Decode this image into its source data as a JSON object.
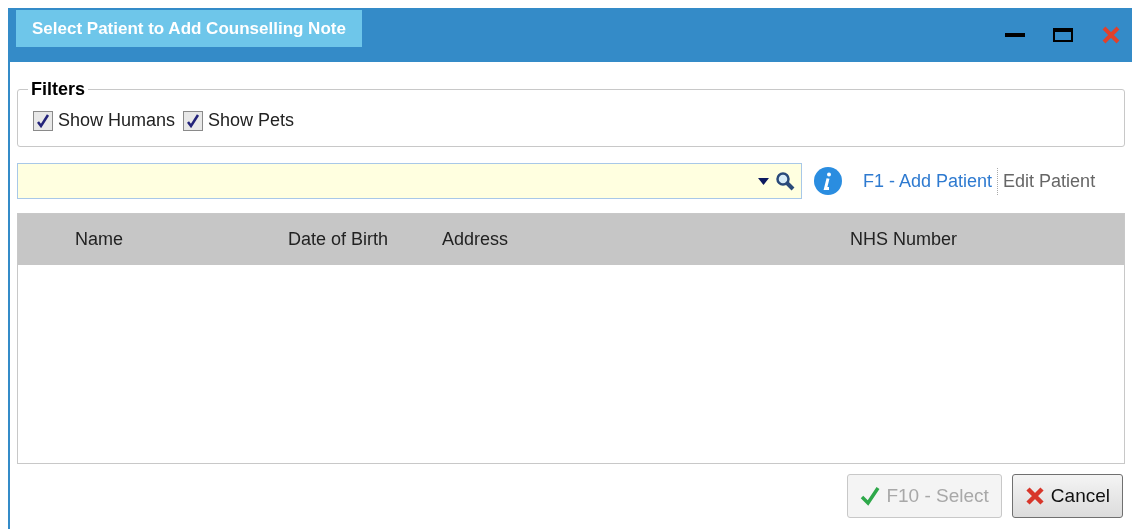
{
  "window": {
    "title": "Select Patient to Add Counselling Note"
  },
  "filters": {
    "legend": "Filters",
    "options": [
      {
        "label": "Show Humans",
        "checked": true
      },
      {
        "label": "Show Pets",
        "checked": true
      }
    ]
  },
  "links": [
    {
      "label": "F1 - Add Patient",
      "disabled": false
    },
    {
      "label": "Edit Patient",
      "disabled": true
    }
  ],
  "table": {
    "columns": [
      "Name",
      "Date of Birth",
      "Address",
      "NHS Number"
    ]
  },
  "buttons": [
    {
      "label": "F10 - Select",
      "kind": "confirm",
      "disabled": true
    },
    {
      "label": "Cancel",
      "kind": "cancel",
      "disabled": false
    }
  ]
}
